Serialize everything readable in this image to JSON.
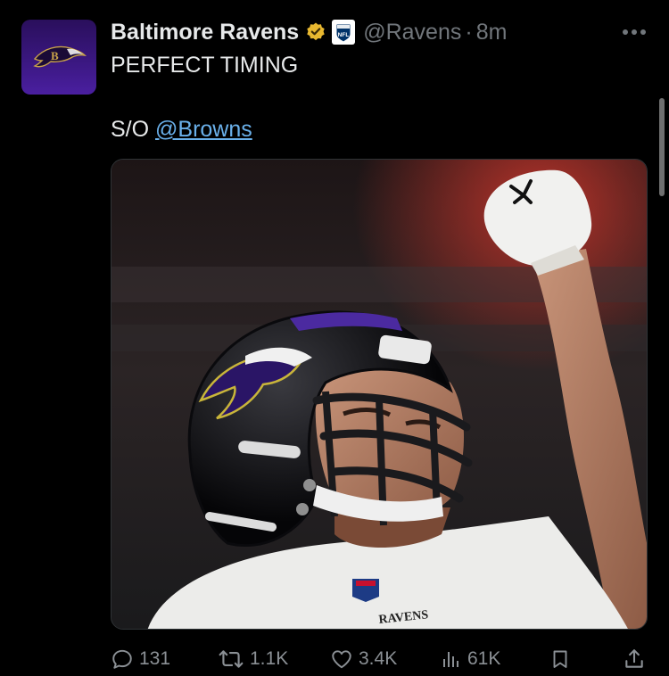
{
  "author": {
    "display_name": "Baltimore Ravens",
    "handle": "@Ravens",
    "separator": "·",
    "time_ago": "8m",
    "avatar_icon": "ravens-logo-icon",
    "verified_icon": "gold-verified-badge-icon",
    "affiliate_badge": "nfl-logo-icon"
  },
  "tweet": {
    "line1": "PERFECT TIMING",
    "line2_prefix": "S/O ",
    "mention": "@Browns",
    "media_alt": "Ravens player in black helmet raising fist",
    "jersey_text": "RAVENS"
  },
  "actions": {
    "replies": "131",
    "reposts": "1.1K",
    "likes": "3.4K",
    "views": "61K"
  },
  "colors": {
    "background": "#000000",
    "text": "#e7e9ea",
    "muted": "#71767b",
    "link": "#6ab0ea",
    "verified_gold": "#e8b830",
    "brand_purple": "#3a1780"
  }
}
